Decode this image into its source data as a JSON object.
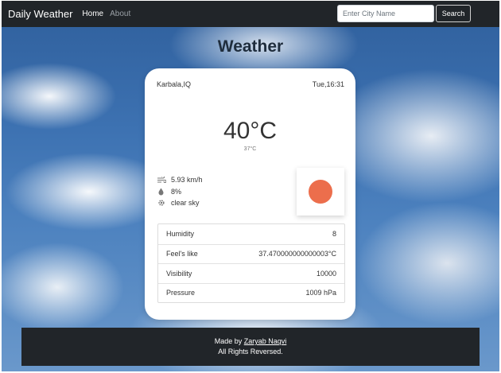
{
  "navbar": {
    "brand": "Daily Weather",
    "links": [
      {
        "label": "Home"
      },
      {
        "label": "About"
      }
    ],
    "search": {
      "placeholder": "Enter City Name",
      "value": "",
      "button_label": "Search"
    }
  },
  "page_title": "Weather",
  "card": {
    "location": "Karbala,IQ",
    "datetime": "Tue,16:31",
    "temperature": "40°C",
    "feels_like_short": "37°C",
    "stats": [
      {
        "icon": "wind-icon",
        "value": "5.93 km/h"
      },
      {
        "icon": "droplet-icon",
        "value": "8%"
      },
      {
        "icon": "settings-icon",
        "value": "clear sky"
      }
    ],
    "weather_icon": {
      "name": "clear-sky-icon",
      "color": "#ec6e4c"
    },
    "details": [
      {
        "label": "Humidity",
        "value": "8"
      },
      {
        "label": "Feel's like",
        "value": "37.470000000000003°C"
      },
      {
        "label": "Visibility",
        "value": "10000"
      },
      {
        "label": "Pressure",
        "value": "1009 hPa"
      }
    ]
  },
  "footer": {
    "made_by_prefix": "Made by",
    "author": "Zaryab Naqvi",
    "rights": "All Rights Reversed."
  },
  "colors": {
    "navbar": "#212529",
    "card": "#ffffff",
    "sun": "#ec6e4c"
  }
}
